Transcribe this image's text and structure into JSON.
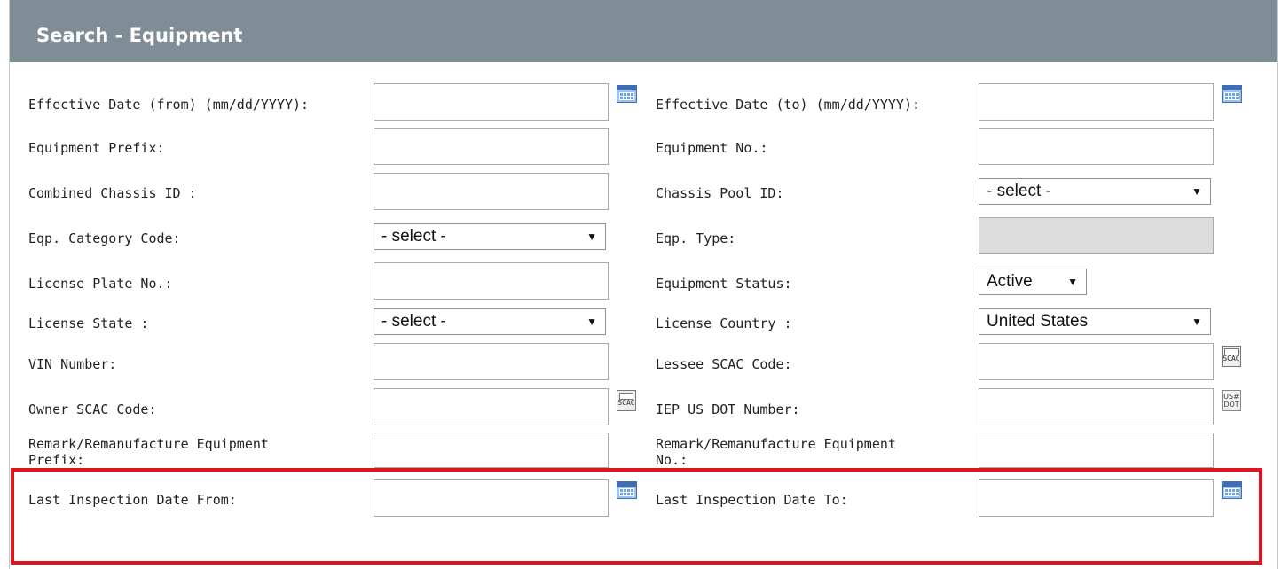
{
  "header": {
    "title": "Search - Equipment"
  },
  "left": {
    "effective_from": "Effective Date (from) (mm/dd/YYYY):",
    "equipment_prefix": "Equipment Prefix:",
    "combined_chassis": "Combined Chassis ID :",
    "eqp_category": "Eqp. Category Code:",
    "license_plate": "License Plate No.:",
    "license_state": "License State :",
    "vin": "VIN Number:",
    "owner_scac": "Owner SCAC Code:",
    "remark_prefix": "Remark/Remanufacture Equipment Prefix:",
    "last_insp_from": "Last Inspection Date From:"
  },
  "right": {
    "effective_to": "Effective Date (to) (mm/dd/YYYY):",
    "equipment_no": "Equipment No.:",
    "chassis_pool": "Chassis Pool ID:",
    "eqp_type": "Eqp. Type:",
    "equipment_status": "Equipment Status:",
    "license_country": "License Country :",
    "lessee_scac": "Lessee SCAC Code:",
    "iep_dot": "IEP US DOT Number:",
    "remark_no": "Remark/Remanufacture Equipment No.:",
    "last_insp_to": "Last Inspection Date To:"
  },
  "selects": {
    "chassis_pool": "- select -",
    "eqp_category": "- select -",
    "equipment_status": "Active",
    "license_state": "- select -",
    "license_country": "United States"
  },
  "icons": {
    "calendar": "calendar-icon",
    "scac": "scac-lookup-icon",
    "dot": "us-dot-lookup-icon",
    "scac_text": "SCAC",
    "dot_text_top": "US#",
    "dot_text_bottom": "DOT"
  },
  "colors": {
    "header_bg": "#7f8d96",
    "highlight": "#e0141e"
  }
}
